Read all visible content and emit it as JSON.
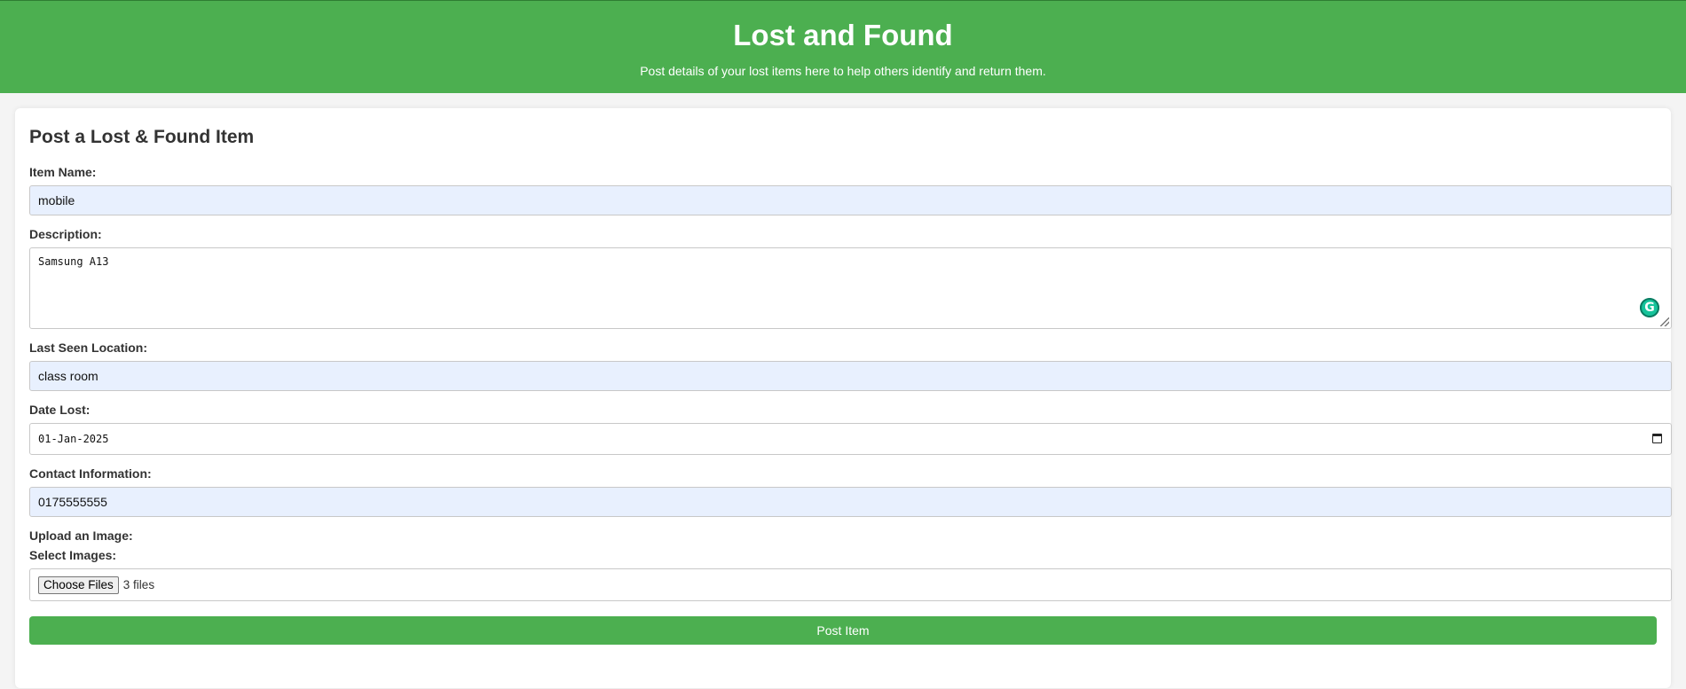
{
  "header": {
    "title": "Lost and Found",
    "subtitle": "Post details of your lost items here to help others identify and return them."
  },
  "form": {
    "heading": "Post a Lost & Found Item",
    "item_name": {
      "label": "Item Name:",
      "value": "mobile"
    },
    "description": {
      "label": "Description:",
      "value": "Samsung A13"
    },
    "location": {
      "label": "Last Seen Location:",
      "value": "class room"
    },
    "date_lost": {
      "label": "Date Lost:",
      "value": "01-Jan-2025"
    },
    "contact": {
      "label": "Contact Information:",
      "value": "0175555555"
    },
    "upload_label": "Upload an Image:",
    "select_images": {
      "label": "Select Images:",
      "button": "Choose Files",
      "status": "3 files"
    },
    "submit_label": "Post Item"
  },
  "colors": {
    "accent": "#4caf50",
    "autofill": "#e8f0fe"
  },
  "icons": {
    "grammarly": "grammarly-icon",
    "calendar": "calendar-icon"
  }
}
